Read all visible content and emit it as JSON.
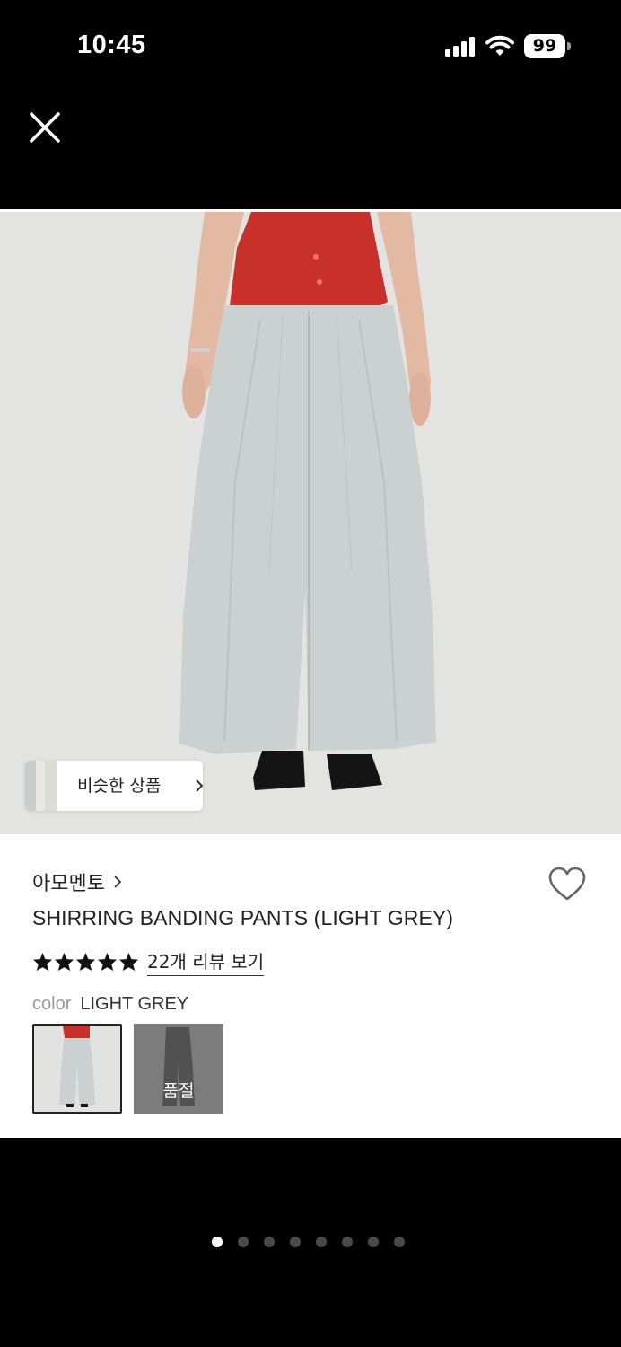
{
  "status_bar": {
    "time": "10:45",
    "battery": "99"
  },
  "product": {
    "brand": "아모멘토",
    "title": "SHIRRING BANDING PANTS (LIGHT GREY)",
    "rating": 5,
    "review_link": "22개 리뷰 보기",
    "color_label": "color",
    "color_value": "LIGHT GREY",
    "sold_out_label": "품절",
    "similar_products_label": "비슷한 상품"
  },
  "icons": [
    "close-icon",
    "heart-icon",
    "star-icon",
    "chevron-right-icon",
    "signal-icon",
    "wifi-icon",
    "battery-icon"
  ],
  "pager": {
    "total": 8,
    "current": 1
  },
  "colors": {
    "background": "#000000",
    "panel": "#ffffff",
    "text": "#222222",
    "muted": "#999999"
  }
}
